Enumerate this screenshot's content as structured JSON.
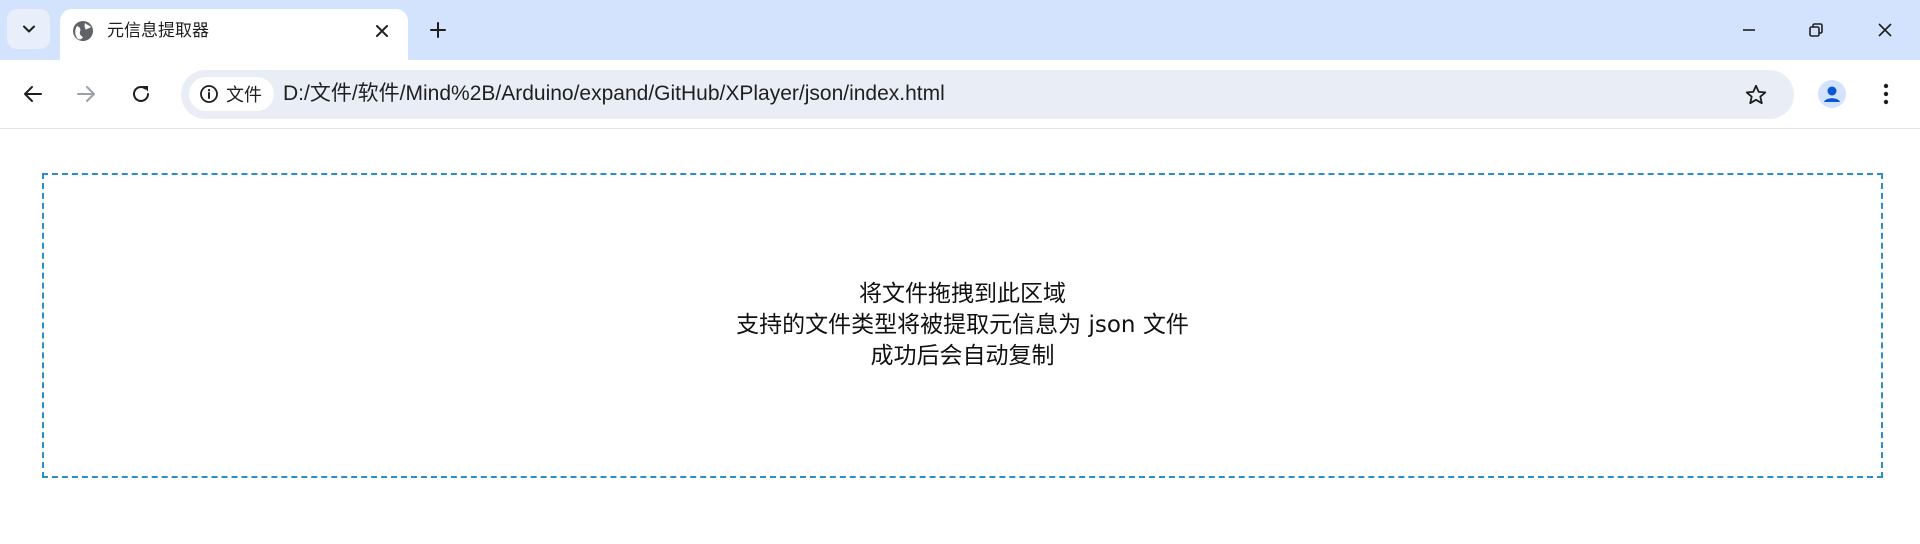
{
  "browser": {
    "tab": {
      "title": "元信息提取器",
      "favicon": "globe-icon"
    },
    "address": {
      "chip_label": "文件",
      "url": "D:/文件/软件/Mind%2B/Arduino/expand/GitHub/XPlayer/json/index.html"
    },
    "accent_color": "#d3e3fd"
  },
  "page": {
    "dropzone": {
      "line1": "将文件拖拽到此区域",
      "line2": "支持的文件类型将被提取元信息为 json 文件",
      "line3": "成功后会自动复制",
      "border_color": "#2a8fc9"
    }
  }
}
